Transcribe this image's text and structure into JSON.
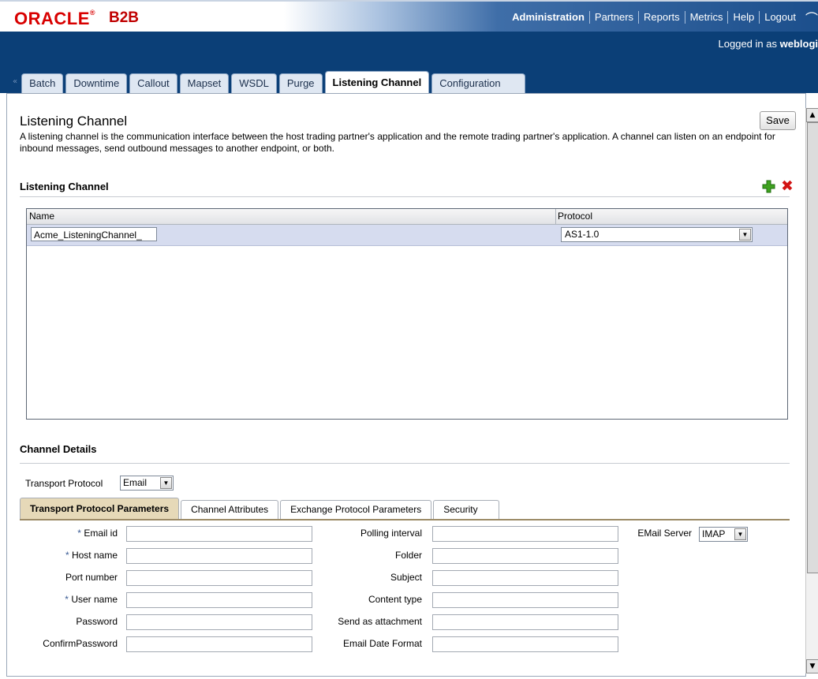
{
  "header": {
    "logo_text": "ORACLE",
    "logo_mark": "®",
    "product": "B2B",
    "brand_red": "#d80000",
    "band_color": "#0b3f77",
    "nav": [
      "Administration",
      "Partners",
      "Reports",
      "Metrics",
      "Help",
      "Logout"
    ],
    "login_prefix": "Logged in as ",
    "login_user": "weblogi"
  },
  "tabs": {
    "collapse_glyph": "«",
    "items": [
      "Batch",
      "Downtime",
      "Callout",
      "Mapset",
      "WSDL",
      "Purge",
      "Listening Channel",
      "Configuration"
    ],
    "active": "Listening Channel"
  },
  "page": {
    "title": "Listening Channel",
    "description": "A listening channel is the communication interface between the host trading partner's application and the remote trading partner's application. A channel can listen on an endpoint for inbound messages, send outbound messages to another endpoint, or both.",
    "save_label": "Save"
  },
  "listening_channel": {
    "header": "Listening Channel",
    "add_icon": "add-plus-icon",
    "delete_icon": "delete-x-icon",
    "columns": [
      "Name",
      "Protocol"
    ],
    "rows": [
      {
        "name": "Acme_ListeningChannel_",
        "protocol": "AS1-1.0"
      }
    ]
  },
  "channel_details": {
    "header": "Channel Details",
    "transport_protocol_label": "Transport Protocol",
    "transport_protocol_value": "Email",
    "subtabs": [
      "Transport Protocol Parameters",
      "Channel Attributes",
      "Exchange Protocol Parameters",
      "Security"
    ],
    "active_subtab": "Transport Protocol Parameters",
    "col1": [
      {
        "label": "Email id",
        "required": true
      },
      {
        "label": "Host name",
        "required": true
      },
      {
        "label": "Port number",
        "required": false
      },
      {
        "label": "User name",
        "required": true
      },
      {
        "label": "Password",
        "required": false
      },
      {
        "label": "ConfirmPassword",
        "required": false
      }
    ],
    "col2": [
      "Polling interval",
      "Folder",
      "Subject",
      "Content type",
      "Send as attachment",
      "Email Date Format"
    ],
    "email_server_label": "EMail Server",
    "email_server_value": "IMAP",
    "required_marker": "*"
  }
}
